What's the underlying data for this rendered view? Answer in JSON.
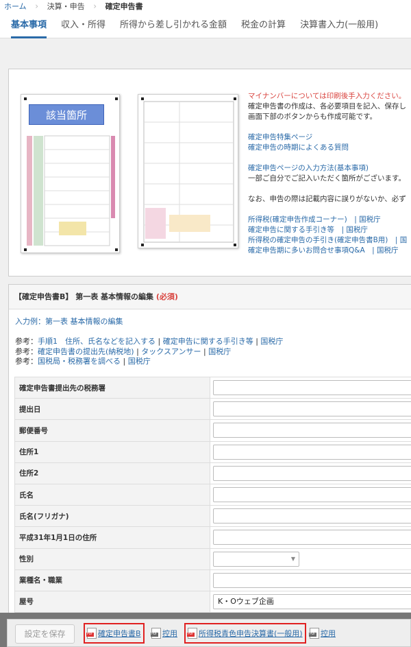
{
  "breadcrumb": [
    "ホーム",
    "決算・申告",
    "確定申告書"
  ],
  "tabs": [
    "基本事項",
    "収入・所得",
    "所得から差し引かれる金額",
    "税金の計算",
    "決算書入力(一般用)"
  ],
  "info": {
    "highlight_label": "該当箇所",
    "notice": "マイナンバーについては印刷後手入力ください。",
    "line1": "確定申告書の作成は、各必要項目を記入、保存し",
    "line2": "画面下部のボタンからも作成可能です。",
    "link_special": "確定申告特集ページ",
    "link_faq": "確定申告の時期によくある質問",
    "link_howto": "確定申告ページの入力方法(基本事項)",
    "line3": "一部ご自分でご記入いただく箇所がございます。",
    "line4": "なお、申告の際は記載内容に誤りがないか、必ず",
    "links_bottom": [
      "所得税(確定申告作成コーナー)　| 国税庁",
      "確定申告に関する手引き等　| 国税庁",
      "所得税の確定申告の手引き(確定申告書B用)　| 国",
      "確定申告期に多いお問合せ事項Q&A　| 国税庁"
    ]
  },
  "form": {
    "title": "【確定申告書B】 第一表 基本情報の編集",
    "required": "(必須)",
    "example_link": "入力例：第一表 基本情報の編集",
    "refs": [
      {
        "label": "参考：",
        "a": "手順1　住所、氏名などを記入する",
        "b": "確定申告に関する手引き等",
        "c": "国税庁"
      },
      {
        "label": "参考：",
        "a": "確定申告書の提出先(納税地)",
        "b": "タックスアンサー",
        "c": "国税庁"
      },
      {
        "label": "参考：",
        "a": "国税局・税務署を調べる",
        "b": "国税庁",
        "c": ""
      }
    ],
    "fields": [
      {
        "label": "確定申告書提出先の税務署",
        "value": ""
      },
      {
        "label": "提出日",
        "value": ""
      },
      {
        "label": "郵便番号",
        "value": ""
      },
      {
        "label": "住所1",
        "value": ""
      },
      {
        "label": "住所2",
        "value": ""
      },
      {
        "label": "氏名",
        "value": ""
      },
      {
        "label": "氏名(フリガナ)",
        "value": ""
      },
      {
        "label": "平成31年1月1日の住所",
        "value": ""
      },
      {
        "label": "性別",
        "value": ""
      },
      {
        "label": "業種名・職業",
        "value": ""
      },
      {
        "label": "屋号",
        "value": "K・Oウェブ企画"
      }
    ]
  },
  "actions": {
    "save": "設定を保存",
    "pdf1": "確定申告書B",
    "copy1": "控用",
    "pdf2": "所得税青色申告決算書(一般用)",
    "copy2": "控用",
    "pdf_tag": "PDF"
  },
  "colors": {
    "accent": "#2a6aa8",
    "notice_red": "#d9443f",
    "highlight_box": "#e02020"
  }
}
